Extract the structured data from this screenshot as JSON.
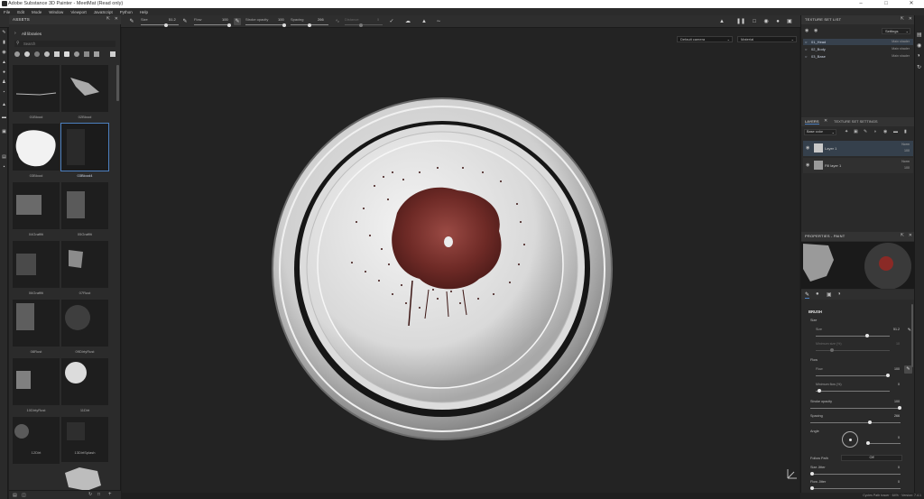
{
  "window": {
    "title": "Adobe Substance 3D Painter - MeetMat (Read only)"
  },
  "menu": [
    "File",
    "Edit",
    "Mode",
    "Window",
    "Viewport",
    "JavaScript",
    "Python",
    "Help"
  ],
  "toolbar": {
    "size_label": "Size",
    "size_value": "51.2",
    "flow_label": "Flow",
    "flow_value": "100",
    "stroke_opacity_label": "Stroke opacity",
    "stroke_opacity_value": "100",
    "spacing_label": "Spacing",
    "spacing_value": "266",
    "distance_label": "Distance",
    "distance_value": "5"
  },
  "assets": {
    "title": "ASSETS",
    "library": "All libraries",
    "search_placeholder": "Search",
    "items": [
      {
        "name": "01Blood"
      },
      {
        "name": "02Blood"
      },
      {
        "name": "03Blood"
      },
      {
        "name": "03Blood4"
      },
      {
        "name": "04Graffiti"
      },
      {
        "name": "05Graffiti"
      },
      {
        "name": "06Graffiti"
      },
      {
        "name": "07Rust"
      },
      {
        "name": "08Rust"
      },
      {
        "name": "09DirtyRust"
      },
      {
        "name": "10DirtyRust"
      },
      {
        "name": "11Dirt"
      },
      {
        "name": "12Dirt"
      },
      {
        "name": "13DirtSplash"
      },
      {
        "name": ""
      }
    ]
  },
  "viewport": {
    "camera": "Default camera",
    "mode": "Material"
  },
  "texture_set_list": {
    "title": "TEXTURE SET LIST",
    "settings": "Settings",
    "sets": [
      {
        "name": "01_Head",
        "shader": "Main shader"
      },
      {
        "name": "02_Body",
        "shader": "Main shader"
      },
      {
        "name": "03_Base",
        "shader": "Main shader"
      }
    ]
  },
  "layers": {
    "tab_layers": "LAYERS",
    "tab_tss": "TEXTURE SET SETTINGS",
    "channel": "Base color",
    "items": [
      {
        "name": "Layer 1",
        "blend": "Norm",
        "opacity": "100"
      },
      {
        "name": "Fill layer 1",
        "blend": "Norm",
        "opacity": "100"
      }
    ]
  },
  "properties": {
    "title": "PROPERTIES - PAINT",
    "section": "BRUSH",
    "size_group": "Size",
    "size_label": "Size",
    "size_value": "51.2",
    "min_size_label": "Minimum size (%)",
    "min_size_value": "10",
    "flow_group": "Flow",
    "flow_label": "Flow",
    "flow_value": "100",
    "min_flow_label": "Minimum flow (%)",
    "min_flow_value": "0",
    "stroke_opacity_label": "Stroke opacity",
    "stroke_opacity_value": "100",
    "spacing_label": "Spacing",
    "spacing_value": "266",
    "angle_label": "Angle",
    "angle_value": "0",
    "follow_path_label": "Follow Path",
    "follow_path_value": "Off",
    "size_jitter_label": "Size Jitter",
    "size_jitter_value": "0",
    "flow_jitter_label": "Flow Jitter",
    "flow_jitter_value": "0"
  },
  "status": {
    "text": "Cycles Path tracer · 64% · Version: 7.4.1"
  }
}
